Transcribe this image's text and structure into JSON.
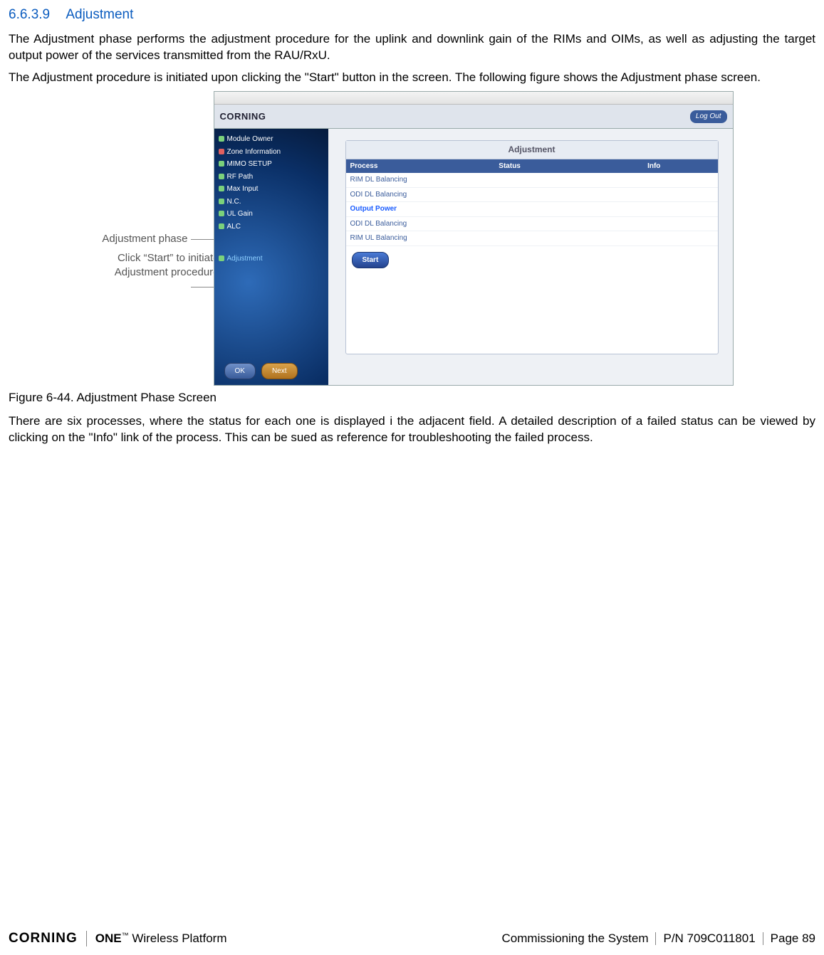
{
  "heading": {
    "number": "6.6.3.9",
    "title": "Adjustment"
  },
  "paragraphs": {
    "p1": "The Adjustment phase performs the adjustment procedure for the uplink and downlink gain of the RIMs and OIMs, as well as adjusting the target output power of the services transmitted from the RAU/RxU.",
    "p2": "The Adjustment procedure is initiated upon clicking the \"Start\" button in the screen. The following figure shows the Adjustment phase screen.",
    "p3": "There are six processes, where the status for each one is displayed i the adjacent field. A detailed description of a failed status can be viewed by clicking on the \"Info\" link of the process. This can be sued as reference for troubleshooting the failed process."
  },
  "annotations": {
    "a1": "Adjustment phase",
    "a2": "Click “Start” to initiate Adjustment procedure"
  },
  "screenshot": {
    "brand": "CORNING",
    "logout": "Log Out",
    "sidebar_items": [
      "Module Owner",
      "Zone Information",
      "MIMO SETUP",
      "RF Path",
      "Max Input",
      "N.C.",
      "UL Gain",
      "ALC"
    ],
    "sidebar_highlight": "Adjustment",
    "panel_title": "Adjustment",
    "columns": {
      "process": "Process",
      "status": "Status",
      "info": "Info"
    },
    "rows": [
      "RIM DL Balancing",
      "ODI DL Balancing",
      "Output Power",
      "ODI DL Balancing",
      "RIM UL Balancing"
    ],
    "start": "Start",
    "ok": "OK",
    "next": "Next"
  },
  "caption": "Figure 6-44. Adjustment Phase Screen",
  "footer": {
    "logo1": "CORNING",
    "logo2_a": "ONE",
    "logo2_b": "Wireless Platform",
    "section": "Commissioning the System",
    "pn": "P/N 709C011801",
    "page": "Page 89"
  }
}
